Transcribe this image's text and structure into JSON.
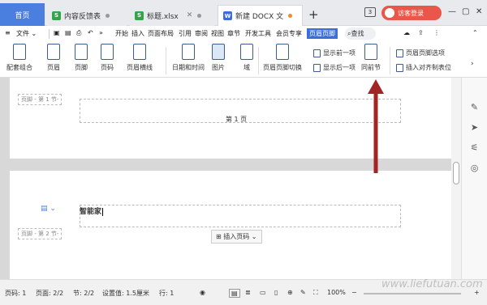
{
  "tabs": {
    "home": "首页",
    "items": [
      {
        "label": "内容反馈表",
        "icon": "S",
        "color": "#2fa64a"
      },
      {
        "label": "标题.xlsx",
        "icon": "S",
        "color": "#2fa64a"
      },
      {
        "label": "新建 DOCX 文",
        "icon": "W",
        "color": "#3c6fd6"
      }
    ],
    "page_count": "3",
    "visitor": "访客登录"
  },
  "menu": {
    "file": "文件",
    "items": [
      "开始",
      "插入",
      "页面布局",
      "引用",
      "审阅",
      "视图",
      "章节",
      "开发工具",
      "会员专享"
    ],
    "active": "页眉页脚",
    "search": "查找"
  },
  "ribbon": {
    "combo": "配套组合",
    "header": "页眉",
    "footer": "页脚",
    "page_num": "页码",
    "header_line": "页眉横线",
    "date_time": "日期和时间",
    "picture": "图片",
    "field": "域",
    "switch": "页眉页脚切换",
    "show_prev": "显示前一项",
    "show_next": "显示后一项",
    "same_prev": "同前节",
    "options": "页眉页脚选项",
    "insert_tab": "插入对齐制表位"
  },
  "doc": {
    "footer_label_1": "页脚 - 第 1 节-",
    "page_text": "第 1 页",
    "header_text": "智能家",
    "footer_label_2": "页脚 - 第 2 节-",
    "insert_page": "插入页码"
  },
  "status": {
    "row": "页码: 1",
    "page": "页面: 2/2",
    "section": "节: 2/2",
    "setting": "设置值: 1.5厘米",
    "line": "行: 1",
    "zoom": "100%"
  },
  "watermark": "www.liefutuan.com",
  "colors": {
    "accent": "#3c6fd6",
    "visitor": "#e9574a",
    "arrow": "#a32424"
  }
}
